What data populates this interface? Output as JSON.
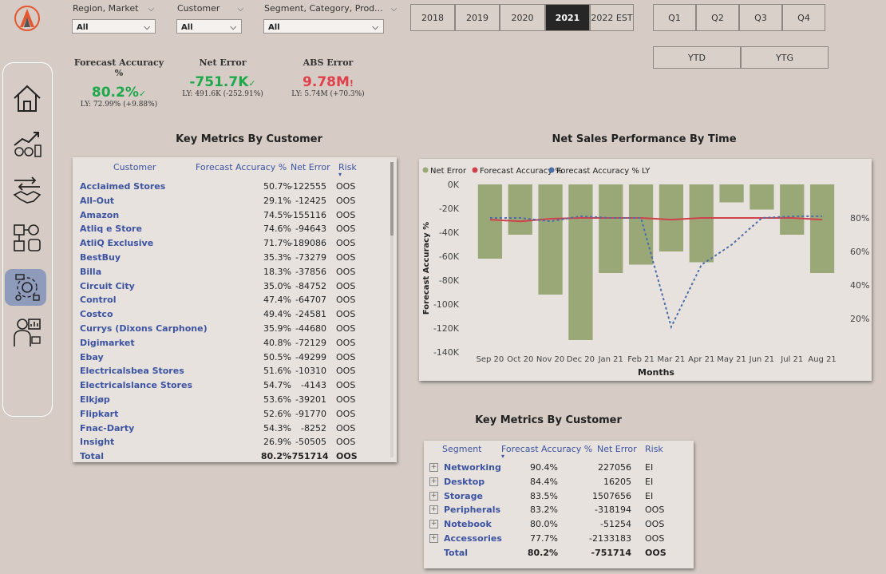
{
  "slicers": [
    {
      "label": "Region, Market",
      "value": "All"
    },
    {
      "label": "Customer",
      "value": "All"
    },
    {
      "label": "Segment, Category, Prod...",
      "value": "All"
    }
  ],
  "years": [
    "2018",
    "2019",
    "2020",
    "2021",
    "2022 EST"
  ],
  "active_year": "2021",
  "quarters": [
    "Q1",
    "Q2",
    "Q3",
    "Q4"
  ],
  "periods": [
    "YTD",
    "YTG"
  ],
  "kpis": [
    {
      "title": "Forecast Accuracy %",
      "value": "80.2%",
      "mark": "✓",
      "sub": "LY: 72.99% (+9.88%)",
      "color": "#1fa84b"
    },
    {
      "title": "Net Error",
      "value": "-751.7K",
      "mark": "✓",
      "sub": "LY: 491.6K (-252.91%)",
      "color": "#1fa84b"
    },
    {
      "title": "ABS Error",
      "value": "9.78M",
      "mark": "!",
      "sub": "LY: 5.74M (+70.3%)",
      "color": "#e0404a"
    }
  ],
  "customer_table": {
    "title": "Key Metrics By Customer",
    "headers": [
      "Customer",
      "Forecast Accuracy %",
      "Net Error",
      "Risk"
    ],
    "rows": [
      [
        "Acclaimed Stores",
        "50.7%",
        "-122555",
        "OOS"
      ],
      [
        "All-Out",
        "29.1%",
        "-12425",
        "OOS"
      ],
      [
        "Amazon",
        "74.5%",
        "-155116",
        "OOS"
      ],
      [
        "Atliq e Store",
        "74.6%",
        "-94643",
        "OOS"
      ],
      [
        "AtliQ Exclusive",
        "71.7%",
        "-189086",
        "OOS"
      ],
      [
        "BestBuy",
        "35.3%",
        "-73279",
        "OOS"
      ],
      [
        "Billa",
        "18.3%",
        "-37856",
        "OOS"
      ],
      [
        "Circuit City",
        "35.0%",
        "-84752",
        "OOS"
      ],
      [
        "Control",
        "47.4%",
        "-64707",
        "OOS"
      ],
      [
        "Costco",
        "49.4%",
        "-24581",
        "OOS"
      ],
      [
        "Currys (Dixons Carphone)",
        "35.9%",
        "-44680",
        "OOS"
      ],
      [
        "Digimarket",
        "40.8%",
        "-72129",
        "OOS"
      ],
      [
        "Ebay",
        "50.5%",
        "-49299",
        "OOS"
      ],
      [
        "Electricalsbea Stores",
        "51.6%",
        "-10310",
        "OOS"
      ],
      [
        "Electricalslance Stores",
        "54.7%",
        "-4143",
        "OOS"
      ],
      [
        "Elkjøp",
        "53.6%",
        "-39201",
        "OOS"
      ],
      [
        "Flipkart",
        "52.6%",
        "-91770",
        "OOS"
      ],
      [
        "Fnac-Darty",
        "54.3%",
        "-8252",
        "OOS"
      ],
      [
        "Insight",
        "26.9%",
        "-50505",
        "OOS"
      ]
    ],
    "total": [
      "Total",
      "80.2%",
      "-751714",
      "OOS"
    ]
  },
  "segment_table": {
    "title": "Key Metrics By Customer",
    "headers": [
      "Segment",
      "Forecast Accuracy %",
      "Net Error",
      "Risk"
    ],
    "rows": [
      [
        "Networking",
        "90.4%",
        "227056",
        "EI"
      ],
      [
        "Desktop",
        "84.4%",
        "16205",
        "EI"
      ],
      [
        "Storage",
        "83.5%",
        "1507656",
        "EI"
      ],
      [
        "Peripherals",
        "83.2%",
        "-318194",
        "OOS"
      ],
      [
        "Notebook",
        "80.0%",
        "-51254",
        "OOS"
      ],
      [
        "Accessories",
        "77.7%",
        "-2133183",
        "OOS"
      ]
    ],
    "total": [
      "Total",
      "80.2%",
      "-751714",
      "OOS"
    ]
  },
  "chart_data": {
    "type": "bar",
    "title": "Net Sales Performance By Time",
    "xlabel": "Months",
    "ylabel": "Forecast Accuracy %",
    "categories": [
      "Sep 20",
      "Oct 20",
      "Nov 20",
      "Dec 20",
      "Jan 21",
      "Feb 21",
      "Mar 21",
      "Apr 21",
      "May 21",
      "Jun 21",
      "Jul 21",
      "Aug 21"
    ],
    "ylim": [
      -140000,
      0
    ],
    "yticks": [
      "0K",
      "-20K",
      "-40K",
      "-60K",
      "-80K",
      "-100K",
      "-120K",
      "-140K"
    ],
    "y2ticks": [
      "80%",
      "60%",
      "40%",
      "20%"
    ],
    "y2lim": [
      0,
      100
    ],
    "series": [
      {
        "name": "Net Error",
        "kind": "bar",
        "color": "#9aa878",
        "values": [
          -62000,
          -42000,
          -92000,
          -130000,
          -74000,
          -67000,
          -56000,
          -65000,
          -15000,
          -21000,
          -42000,
          -74000
        ]
      },
      {
        "name": "Forecast Accuracy %",
        "kind": "line",
        "color": "#d0414b",
        "values": [
          79,
          78,
          79.5,
          80,
          80,
          80,
          79,
          80,
          80,
          80,
          80,
          79
        ]
      },
      {
        "name": "Forecast Accuracy % LY",
        "kind": "dashed",
        "color": "#4a6ea8",
        "values": [
          80,
          80,
          78,
          81,
          80,
          80,
          15,
          52,
          64,
          80,
          81,
          81
        ]
      }
    ]
  }
}
